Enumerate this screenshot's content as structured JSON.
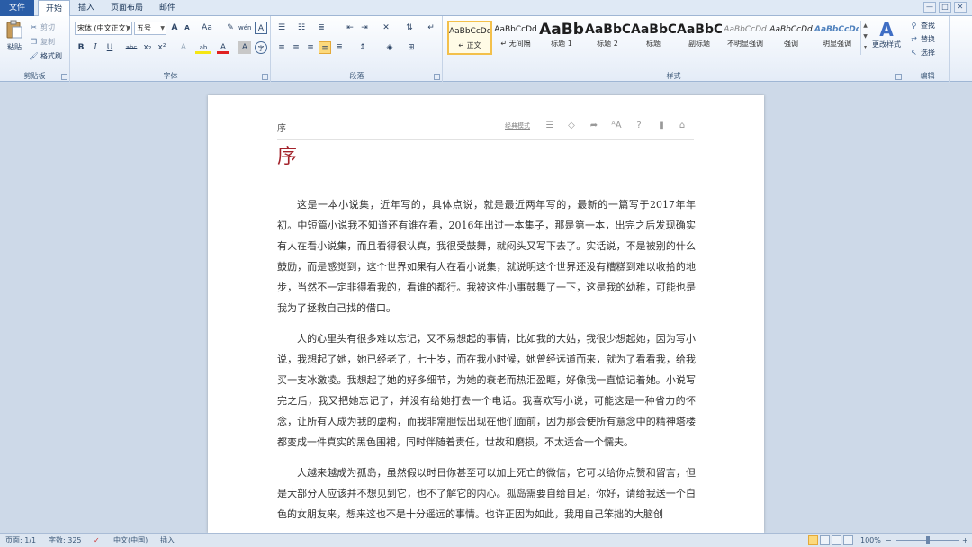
{
  "tabs": {
    "file": "文件",
    "items": [
      "开始",
      "插入",
      "页面布局",
      "邮件"
    ],
    "active_index": 0
  },
  "window_controls": [
    "—",
    "□",
    "✕"
  ],
  "clipboard": {
    "paste": "粘贴",
    "cut": "剪切",
    "copy": "复制",
    "format_painter": "格式刷",
    "label": "剪贴板"
  },
  "font": {
    "font_name": "宋体 (中文正文)",
    "font_size": "五号",
    "grow": "A",
    "shrink": "A",
    "case": "Aa",
    "clear": "✎",
    "pinyin": "wén",
    "char_border": "A",
    "bold": "B",
    "italic": "I",
    "underline": "U",
    "strike": "abc",
    "subscript": "x₂",
    "superscript": "x²",
    "effects": "A",
    "highlight": "ab",
    "color": "A",
    "shade": "A",
    "enclose": "字",
    "label": "字体"
  },
  "paragraph": {
    "label": "段落"
  },
  "styles": {
    "items": [
      {
        "sample": "AaBbCcDd",
        "name": "↵ 正文"
      },
      {
        "sample": "AaBbCcDd",
        "name": "↵ 无间隔"
      },
      {
        "sample": "AaBb",
        "name": "标题 1"
      },
      {
        "sample": "AaBbC",
        "name": "标题 2"
      },
      {
        "sample": "AaBbC",
        "name": "标题"
      },
      {
        "sample": "AaBbC",
        "name": "副标题"
      },
      {
        "sample": "AaBbCcDd",
        "name": "不明显强调"
      },
      {
        "sample": "AaBbCcDd",
        "name": "强调"
      },
      {
        "sample": "AaBbCcDd",
        "name": "明显强调"
      }
    ],
    "change_styles": "更改样式",
    "label": "样式"
  },
  "editing": {
    "find": "查找",
    "replace": "替换",
    "select": "选择",
    "label": "编辑"
  },
  "document": {
    "running_title": "序",
    "mode_link": "经典模式",
    "chapter_title": "序",
    "paragraphs": [
      "这是一本小说集，近年写的，具体点说，就是最近两年写的，最新的一篇写于2017年年初。中短篇小说我不知道还有谁在看，2016年出过一本集子，那是第一本，出完之后发现确实有人在看小说集，而且看得很认真，我很受鼓舞，就闷头又写下去了。实话说，不是被别的什么鼓励，而是感觉到，这个世界如果有人在看小说集，就说明这个世界还没有糟糕到难以收拾的地步，当然不一定非得看我的，看谁的都行。我被这件小事鼓舞了一下，这是我的幼稚，可能也是我为了拯救自己找的借口。",
      "人的心里头有很多难以忘记，又不易想起的事情，比如我的大姑，我很少想起她，因为写小说，我想起了她，她已经老了，七十岁，而在我小时候，她曾经远道而来，就为了看看我，给我买一支冰激凌。我想起了她的好多细节，为她的衰老而热泪盈眶，好像我一直惦记着她。小说写完之后，我又把她忘记了，并没有给她打去一个电话。我喜欢写小说，可能这是一种省力的怀念，让所有人成为我的虚构，而我非常胆怯出现在他们面前，因为那会使所有意念中的精神塔楼都变成一件真实的黑色围裙，同时伴随着责任，世故和磨损，不太适合一个懦夫。",
      "人越来越成为孤岛，虽然假以时日你甚至可以加上死亡的微信，它可以给你点赞和留言，但是大部分人应该并不想见到它，也不了解它的内心。孤岛需要自给自足，你好，请给我送一个白色的女朋友来，想来这也不是十分遥远的事情。也许正因为如此，我用自己笨拙的大脑创"
    ]
  },
  "status": {
    "page": "页面: 1/1",
    "words": "字数: 325",
    "language": "中文(中国)",
    "mode": "插入",
    "zoom": "100%",
    "zoom_out": "−",
    "zoom_in": "+"
  }
}
